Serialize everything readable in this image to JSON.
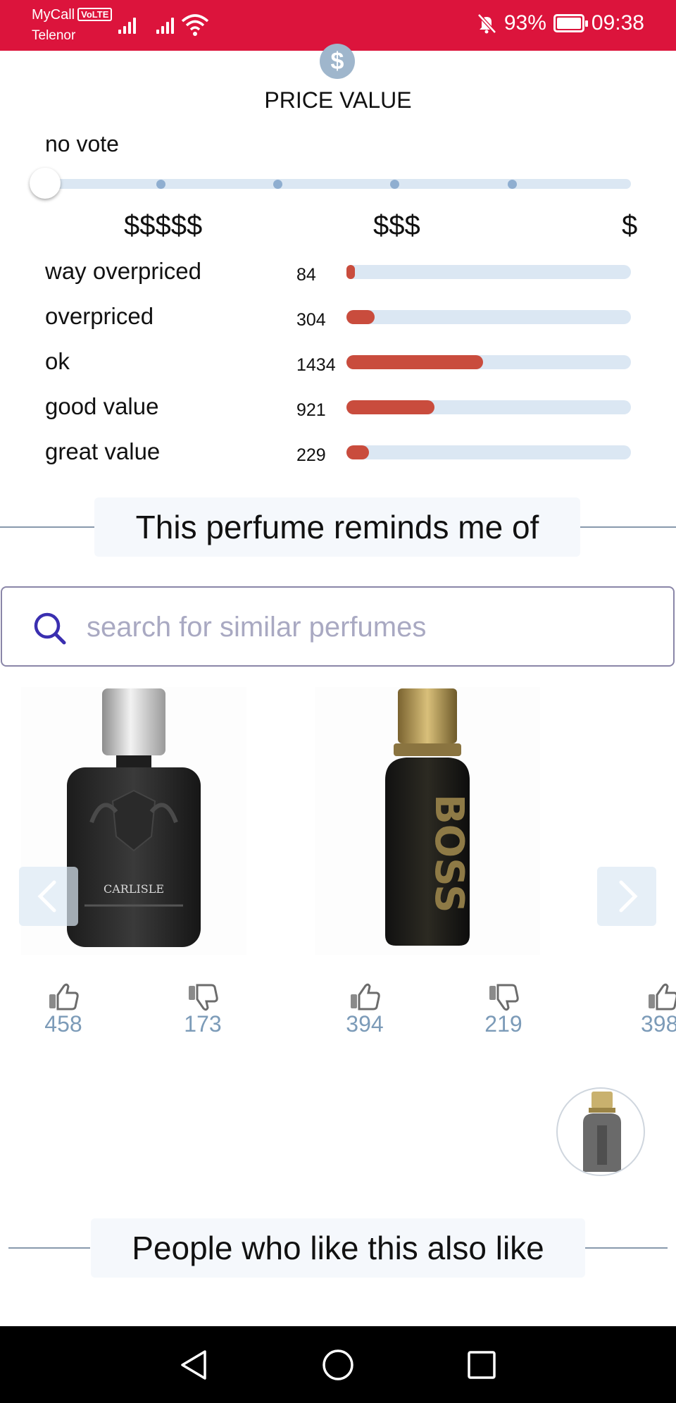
{
  "status_bar": {
    "carrier_top": "MyCall",
    "volte": "VoLTE",
    "carrier_bottom": "Telenor",
    "battery": "93%",
    "time": "09:38"
  },
  "price_value": {
    "title": "PRICE VALUE",
    "vote_status": "no vote",
    "slider_position": 0,
    "scale_labels": [
      "$$$$$",
      "$$$",
      "$"
    ],
    "rows": [
      {
        "label": "way overpriced",
        "count": "84",
        "fraction": 0.03
      },
      {
        "label": "overpriced",
        "count": "304",
        "fraction": 0.1
      },
      {
        "label": "ok",
        "count": "1434",
        "fraction": 0.48
      },
      {
        "label": "good value",
        "count": "921",
        "fraction": 0.31
      },
      {
        "label": "great value",
        "count": "229",
        "fraction": 0.08
      }
    ],
    "bar_color": "#c94c3d"
  },
  "reminds_section": {
    "title": "This perfume reminds me of",
    "search_placeholder": "search for similar perfumes"
  },
  "similar_perfumes": [
    {
      "bottle_text": "CARLISLE",
      "likes": "458",
      "dislikes": "173"
    },
    {
      "bottle_text": "BOSS",
      "likes": "394",
      "dislikes": "219"
    },
    {
      "bottle_text": "",
      "likes": "398",
      "dislikes": ""
    }
  ],
  "also_like_section": {
    "title": "People who like this also like"
  },
  "icons": {
    "price": "dollar-icon",
    "search": "search-icon",
    "like": "thumbs-up-icon",
    "dislike": "thumbs-down-icon",
    "prev": "chevron-left-icon",
    "next": "chevron-right-icon",
    "nav_back": "triangle-back-icon",
    "nav_home": "circle-home-icon",
    "nav_recent": "square-recents-icon"
  },
  "colors": {
    "status_bar": "#dc143c",
    "accent_bar": "#c94c3d",
    "track": "#dbe7f3",
    "vote_count": "#7c9bb8"
  }
}
